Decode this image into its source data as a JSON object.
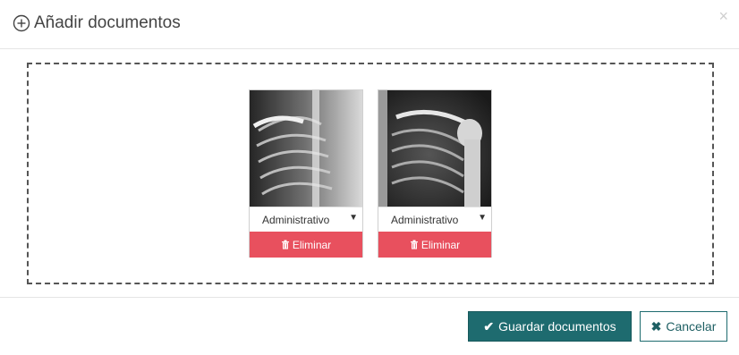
{
  "header": {
    "title": "Añadir documentos",
    "plus_icon": "plus-circle-icon",
    "close_symbol": "×"
  },
  "documents": [
    {
      "type_label": "Administrativo",
      "delete_label": "Eliminar"
    },
    {
      "type_label": "Administrativo",
      "delete_label": "Eliminar"
    }
  ],
  "footer": {
    "save_label": "Guardar documentos",
    "cancel_label": "Cancelar"
  },
  "colors": {
    "delete": "#e8505e",
    "primary": "#1e6b6f"
  }
}
